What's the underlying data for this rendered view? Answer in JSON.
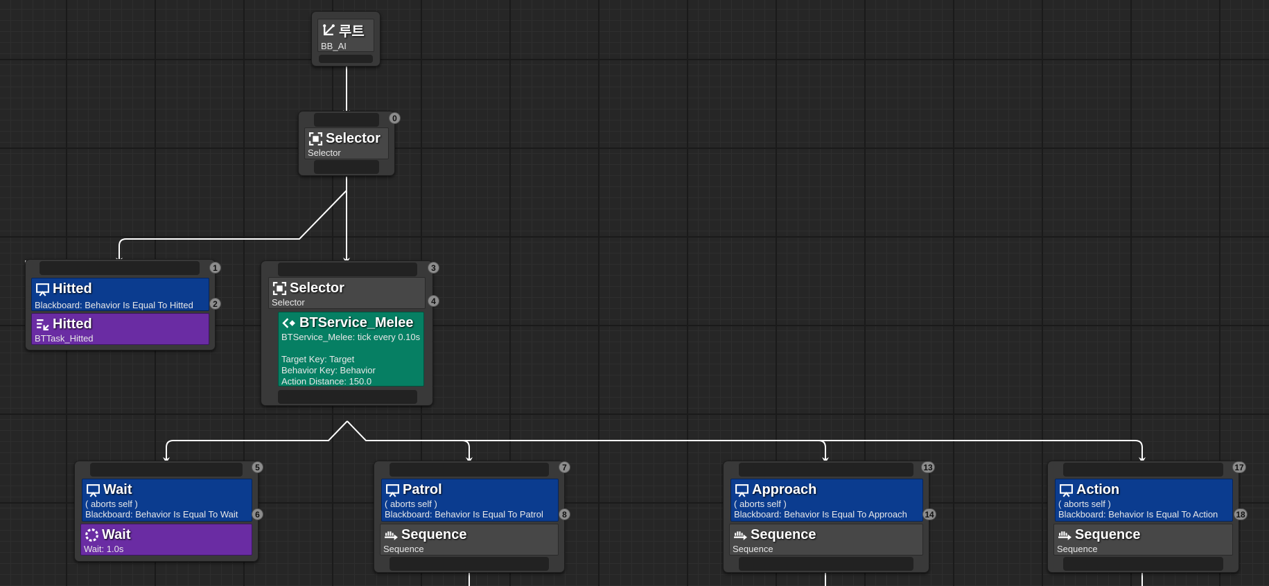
{
  "root": {
    "title": "루트",
    "blackboard": "BB_AI"
  },
  "selector_main": {
    "title": "Selector",
    "subtitle": "Selector",
    "index": "0"
  },
  "hitted_branch": {
    "index": "1",
    "decorator": {
      "title": "Hitted",
      "detail": "Blackboard: Behavior Is Equal To Hitted",
      "index": "2"
    },
    "task": {
      "title": "Hitted",
      "detail": "BTTask_Hitted"
    }
  },
  "selector_melee": {
    "title": "Selector",
    "subtitle": "Selector",
    "index": "3",
    "service": {
      "index": "4",
      "title": "BTService_Melee",
      "lines": [
        "BTService_Melee: tick every 0.10s",
        "",
        "Target Key: Target",
        "Behavior Key: Behavior",
        "Action Distance: 150.0"
      ]
    }
  },
  "wait_branch": {
    "index": "5",
    "decorator": {
      "title": "Wait",
      "abort": "( aborts self )",
      "detail": "Blackboard: Behavior Is Equal To Wait",
      "index": "6"
    },
    "task": {
      "title": "Wait",
      "detail": "Wait: 1.0s"
    }
  },
  "patrol_branch": {
    "index": "7",
    "decorator": {
      "title": "Patrol",
      "abort": "( aborts self )",
      "detail": "Blackboard: Behavior Is Equal To Patrol",
      "index": "8"
    },
    "composite": {
      "title": "Sequence",
      "subtitle": "Sequence"
    }
  },
  "approach_branch": {
    "index": "13",
    "decorator": {
      "title": "Approach",
      "abort": "( aborts self )",
      "detail": "Blackboard: Behavior Is Equal To Approach",
      "index": "14"
    },
    "composite": {
      "title": "Sequence",
      "subtitle": "Sequence"
    }
  },
  "action_branch": {
    "index": "17",
    "decorator": {
      "title": "Action",
      "abort": "( aborts self )",
      "detail": "Blackboard: Behavior Is Equal To Action",
      "index": "18"
    },
    "composite": {
      "title": "Sequence",
      "subtitle": "Sequence"
    }
  },
  "colors": {
    "decorator": "#0b3c8f",
    "task": "#6a2ca3",
    "service": "#067f63",
    "composite": "#474747",
    "node_body": "#393939",
    "wire": "#ffffff",
    "background": "#262626"
  }
}
